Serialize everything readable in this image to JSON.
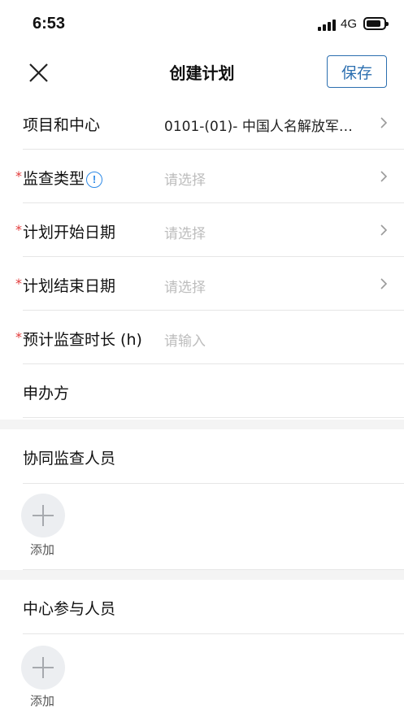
{
  "status_bar": {
    "time": "6:53",
    "network": "4G"
  },
  "nav": {
    "title": "创建计划",
    "save_label": "保存"
  },
  "form": {
    "project": {
      "label": "项目和中心",
      "value": "0101-(01)- 中国人名解放军…"
    },
    "inspection_type": {
      "label": "监查类型",
      "placeholder": "请选择",
      "required_mark": "*",
      "info_glyph": "!"
    },
    "start_date": {
      "label": "计划开始日期",
      "placeholder": "请选择",
      "required_mark": "*"
    },
    "end_date": {
      "label": "计划结束日期",
      "placeholder": "请选择",
      "required_mark": "*"
    },
    "duration": {
      "label": "预计监查时长 (h)",
      "placeholder": "请输入",
      "required_mark": "*"
    },
    "sponsor": {
      "label": "申办方"
    }
  },
  "sections": {
    "co_inspectors": {
      "title": "协同监查人员",
      "add_label": "添加"
    },
    "center_participants": {
      "title": "中心参与人员",
      "add_label": "添加"
    }
  },
  "colors": {
    "accent": "#2c6fb0",
    "required": "#e23b3b",
    "info": "#2e8ae6",
    "placeholder": "#bdbdbd"
  }
}
